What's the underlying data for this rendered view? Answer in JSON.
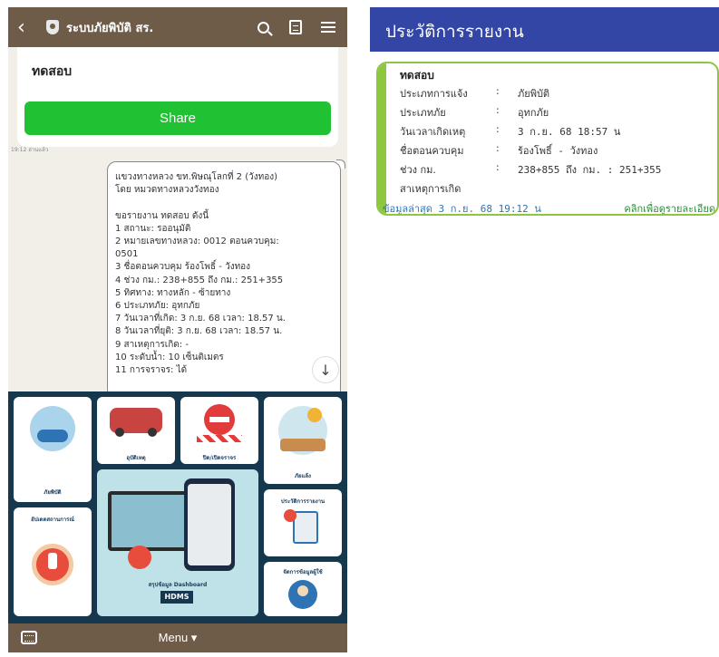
{
  "left_app": {
    "title": "ระบบภัยพิบัติ สร.",
    "card_title": "ทดสอบ",
    "share_label": "Share",
    "message_meta": "19:12 อ่านแล้ว",
    "message_lines": [
      "แขวงทางหลวง ขท.พิษณุโลกที่ 2 (วังทอง)",
      "โดย หมวดทางหลวงวังทอง",
      "",
      "ขอรายงาน ทดสอบ ดังนี้",
      "1 สถานะ: รออนุมัติ",
      "2 หมายเลขทางหลวง: 0012 ตอนควบคุม:",
      "0501",
      "3 ชื่อตอนควบคุม ร้องโพธิ์ - วังทอง",
      "4 ช่วง กม.: 238+855 ถึง กม.: 251+355",
      "5 ทิศทาง: ทางหลัก - ซ้ายทาง",
      "6 ประเภทภัย: อุทกภัย",
      "7 วันเวลาที่เกิด: 3 ก.ย. 68 เวลา: 18.57 น.",
      "8 วันเวลาที่ยุติ: 3 ก.ย. 68 เวลา: 18.57 น.",
      "9 สาเหตุการเกิด: -",
      "10 ระดับน้ำ: 10 เซ็นติเมตร",
      "11 การจราจร: ได้"
    ],
    "tiles": [
      {
        "label": "ภัยพิบัติ",
        "icon": "disaster-flood-icon"
      },
      {
        "label": "อุบัติเหตุ",
        "icon": "car-accident-icon"
      },
      {
        "label": "ปิด/เปิดจราจร",
        "icon": "road-closed-icon"
      },
      {
        "label": "ภัยแล้ง",
        "icon": "drought-icon"
      },
      {
        "label": "อัปเดตสถานการณ์",
        "icon": "alert-update-icon"
      },
      {
        "label": "สรุปข้อมูล Dashboard",
        "icon": "dashboard-map-icon"
      },
      {
        "label": "HDMS",
        "icon": "hdms-logo"
      },
      {
        "label": "ประวัติการรายงาน",
        "icon": "report-history-icon"
      },
      {
        "label": "จัดการข้อมูลผู้ใช้",
        "icon": "user-manage-icon"
      }
    ],
    "bottom_menu_label": "Menu ▾"
  },
  "right_app": {
    "header_title": "ประวัติการรายงาน",
    "card_title": "ทดสอบ",
    "rows": [
      {
        "label": "ประเภทการแจ้ง",
        "value": "ภัยพิบัติ"
      },
      {
        "label": "ประเภทภัย",
        "value": "อุทกภัย"
      },
      {
        "label": "วันเวลาเกิดเหตุ",
        "value": "3 ก.ย. 68 18:57 น"
      },
      {
        "label": "ชื่อตอนควบคุม",
        "value": "ร้องโพธิ์ - วังทอง"
      },
      {
        "label": "ช่วง กม.",
        "value": "238+855  ถึง กม.   : 251+355"
      },
      {
        "label": "สาเหตุการเกิด",
        "value": ""
      }
    ],
    "footer_updated": "ข้อมูลล่าสุด 3 ก.ย. 68 19:12 น",
    "footer_link": "คลิกเพื่อดูรายละเอียด"
  }
}
